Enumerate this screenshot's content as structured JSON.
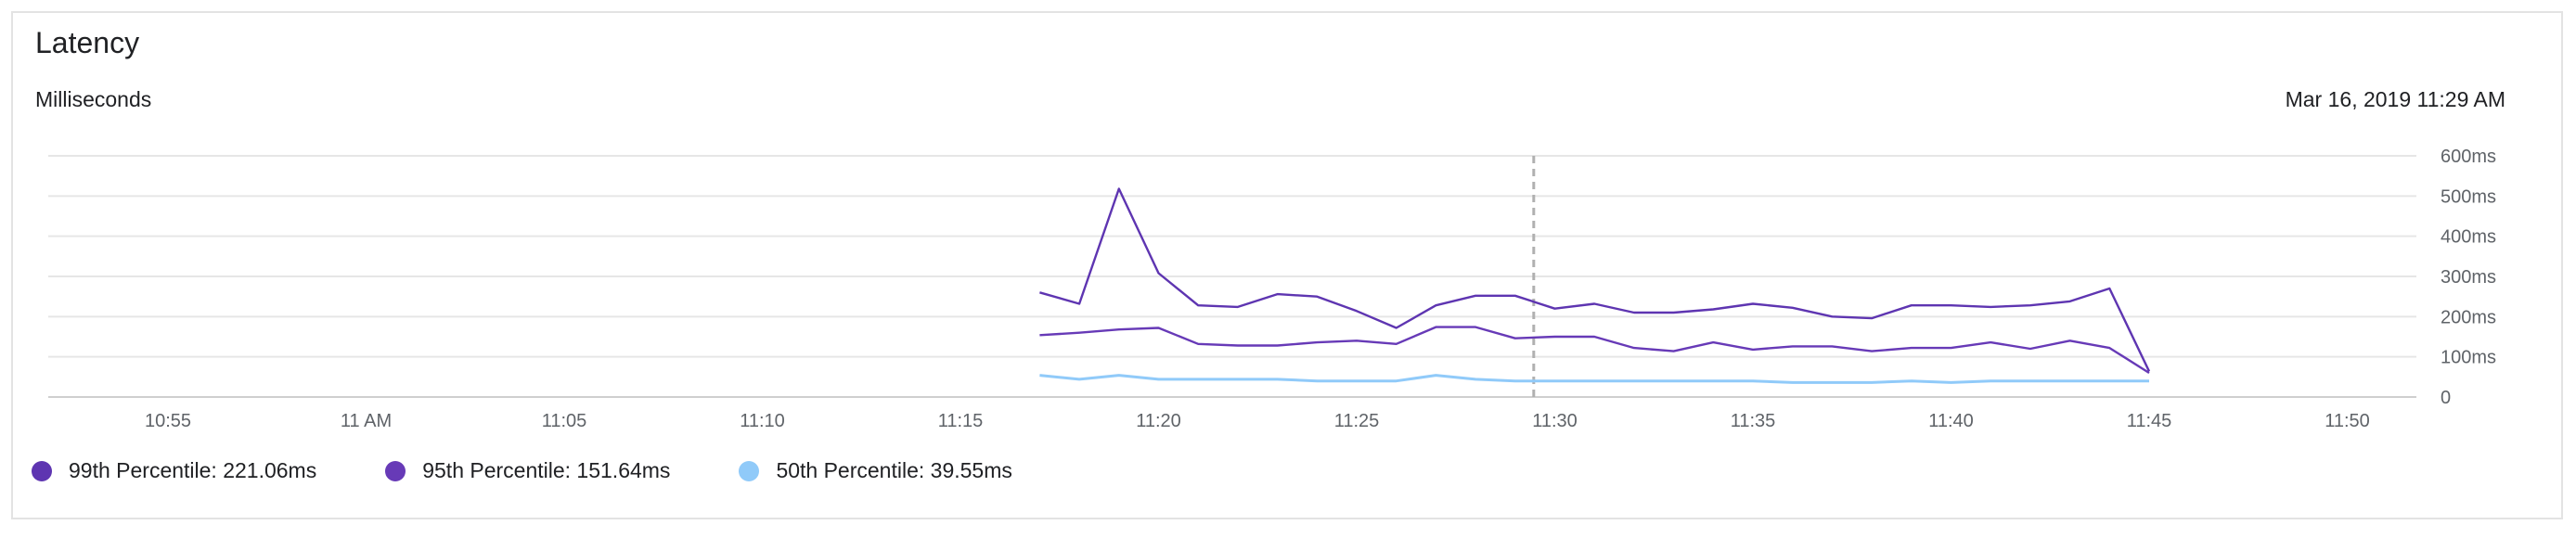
{
  "header": {
    "title": "Latency",
    "subtitle": "Milliseconds",
    "timestamp": "Mar 16, 2019 11:29 AM"
  },
  "colors": {
    "p99": "#5e35b1",
    "p95": "#673ab7",
    "p50": "#90caf9",
    "grid": "#e6e6e6",
    "cursor": "#b0b0b0",
    "axis_text": "#5f6368"
  },
  "legend": [
    {
      "name": "99th Percentile",
      "value_text": "99th Percentile: 221.06ms",
      "color": "#5e35b1"
    },
    {
      "name": "95th Percentile",
      "value_text": "95th Percentile: 151.64ms",
      "color": "#673ab7"
    },
    {
      "name": "50th Percentile",
      "value_text": "50th Percentile: 39.55ms",
      "color": "#90caf9"
    }
  ],
  "chart_data": {
    "type": "line",
    "title": "Latency",
    "ylabel": "Milliseconds",
    "ylim": [
      0,
      600
    ],
    "y_ticks": [
      0,
      100,
      200,
      300,
      400,
      500,
      600
    ],
    "y_tick_labels": [
      "0",
      "100ms",
      "200ms",
      "300ms",
      "400ms",
      "500ms",
      "600ms"
    ],
    "x_ticks": [
      "10:55",
      "11 AM",
      "11:05",
      "11:10",
      "11:15",
      "11:20",
      "11:25",
      "11:30",
      "11:35",
      "11:40",
      "11:45",
      "11:50"
    ],
    "xlim": [
      "10:52:30",
      "11:52:15"
    ],
    "x_time_unit": "minutes after 10:52:30 for x positions below are derived in script from clock times",
    "cursor_time": "11:29",
    "grid": true,
    "legend_position": "bottom-left",
    "x": [
      "11:17",
      "11:18",
      "11:19",
      "11:20",
      "11:21",
      "11:22",
      "11:23",
      "11:24",
      "11:25",
      "11:26",
      "11:27",
      "11:28",
      "11:29",
      "11:30",
      "11:31",
      "11:32",
      "11:33",
      "11:34",
      "11:35",
      "11:36",
      "11:37",
      "11:38",
      "11:39",
      "11:40",
      "11:41",
      "11:42",
      "11:43",
      "11:44",
      "11:45"
    ],
    "series": [
      {
        "name": "99th Percentile",
        "color": "#5e35b1",
        "values": [
          260,
          232,
          518,
          308,
          228,
          224,
          256,
          250,
          214,
          172,
          228,
          252,
          252,
          220,
          232,
          210,
          210,
          218,
          232,
          222,
          200,
          196,
          228,
          228,
          224,
          228,
          238,
          270,
          64
        ]
      },
      {
        "name": "95th Percentile",
        "color": "#673ab7",
        "values": [
          154,
          160,
          168,
          172,
          132,
          128,
          128,
          136,
          140,
          132,
          174,
          174,
          146,
          150,
          150,
          122,
          114,
          136,
          118,
          126,
          126,
          114,
          122,
          122,
          136,
          120,
          140,
          122,
          60
        ]
      },
      {
        "name": "50th Percentile",
        "color": "#90caf9",
        "values": [
          54,
          44,
          54,
          44,
          44,
          44,
          44,
          40,
          40,
          40,
          54,
          44,
          40,
          40,
          40,
          40,
          40,
          40,
          40,
          36,
          36,
          36,
          40,
          36,
          40,
          40,
          40,
          40,
          40
        ]
      }
    ]
  }
}
